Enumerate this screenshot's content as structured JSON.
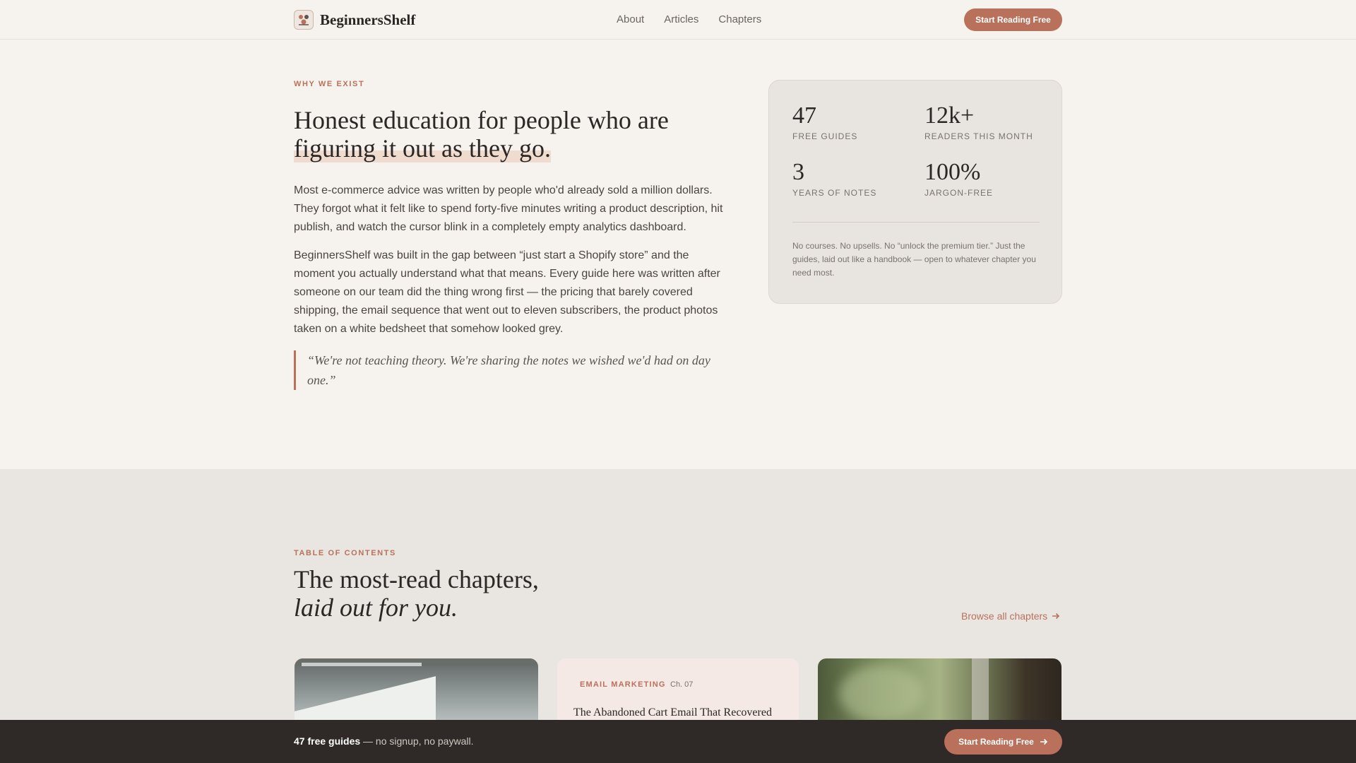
{
  "nav": {
    "brand": "BeginnersShelf",
    "links": [
      "About",
      "Articles",
      "Chapters"
    ],
    "cta": "Start Reading Free"
  },
  "hero": {
    "eyebrow": "WHY WE EXIST",
    "title_plain": "Honest education for people who are",
    "title_highlight": "figuring it out as they go.",
    "paragraph1": "Most e-commerce advice was written by people who'd already sold a million dollars. They forgot what it felt like to spend forty-five minutes writing a product description, hit publish, and watch the cursor blink in a completely empty analytics dashboard.",
    "paragraph2": "BeginnersShelf was built in the gap between “just start a Shopify store” and the moment you actually understand what that means. Every guide here was written after someone on our team did the thing wrong first — the pricing that barely covered shipping, the email sequence that went out to eleven subscribers, the product photos taken on a white bedsheet that somehow looked grey.",
    "quote": "“We're not teaching theory. We're sharing the notes we wished we'd had on day one.”"
  },
  "stats": {
    "items": [
      {
        "value": "47",
        "label": "FREE GUIDES"
      },
      {
        "value": "12k+",
        "label": "READERS THIS MONTH"
      },
      {
        "value": "3",
        "label": "YEARS OF NOTES"
      },
      {
        "value": "100%",
        "label": "JARGON-FREE"
      }
    ],
    "note": "No courses. No upsells. No “unlock the premium tier.” Just the guides, laid out like a handbook — open to whatever chapter you need most."
  },
  "toc": {
    "eyebrow": "TABLE OF CONTENTS",
    "title_line1": "The most-read chapters,",
    "title_line2": "laid out for you.",
    "browse": "Browse all chapters",
    "cards": [
      {
        "tag": "EMAIL MARKETING",
        "chapter": "Ch. 07",
        "title": "The Abandoned Cart Email That Recovered"
      }
    ]
  },
  "sticky": {
    "bold": "47 free guides",
    "rest": " — no signup, no paywall.",
    "cta": "Start Reading Free"
  },
  "colors": {
    "accent": "#b9715b",
    "background": "#f6f3ee",
    "dark_bar": "#2f2a27"
  }
}
